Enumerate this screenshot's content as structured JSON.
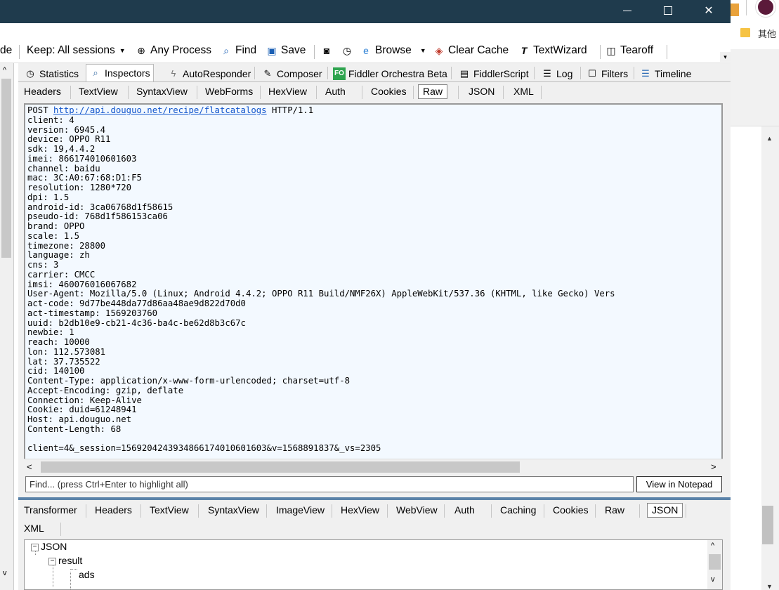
{
  "window": {
    "minimize_icon": "minimize-icon",
    "maximize_icon": "maximize-icon",
    "close_icon": "close-icon",
    "titlebar_color": "#1f3b4d"
  },
  "background_browser": {
    "bookmark_folder": "其他"
  },
  "toolbar": {
    "cut_label": "de",
    "keep_label": "Keep: All sessions",
    "any_process": "Any Process",
    "find": "Find",
    "save": "Save",
    "browse": "Browse",
    "clear_cache": "Clear Cache",
    "textwizard": "TextWizard",
    "tearoff": "Tearoff"
  },
  "tabs": {
    "statistics": "Statistics",
    "inspectors": "Inspectors",
    "autoresponder": "AutoResponder",
    "composer": "Composer",
    "fo_badge": "FO",
    "fiddler_orchestra": "Fiddler Orchestra Beta",
    "fiddlerscript": "FiddlerScript",
    "log": "Log",
    "filters": "Filters",
    "timeline": "Timeline"
  },
  "request_tabs": [
    "Headers",
    "TextView",
    "SyntaxView",
    "WebForms",
    "HexView",
    "Auth",
    "Cookies",
    "Raw",
    "JSON",
    "XML"
  ],
  "raw": {
    "method": "POST ",
    "url": "http://api.douguo.net/recipe/flatcatalogs",
    "protocol": " HTTP/1.1",
    "headers": "client: 4\nversion: 6945.4\ndevice: OPPO R11\nsdk: 19,4.4.2\nimei: 866174010601603\nchannel: baidu\nmac: 3C:A0:67:68:D1:F5\nresolution: 1280*720\ndpi: 1.5\nandroid-id: 3ca06768d1f58615\npseudo-id: 768d1f586153ca06\nbrand: OPPO\nscale: 1.5\ntimezone: 28800\nlanguage: zh\ncns: 3\ncarrier: CMCC\nimsi: 460076016067682\nUser-Agent: Mozilla/5.0 (Linux; Android 4.4.2; OPPO R11 Build/NMF26X) AppleWebKit/537.36 (KHTML, like Gecko) Vers\nact-code: 9d77be448da77d86aa48ae9d822d70d0\nact-timestamp: 1569203760\nuuid: b2db10e9-cb21-4c36-ba4c-be62d8b3c67c\nnewbie: 1\nreach: 10000\nlon: 112.573081\nlat: 37.735522\ncid: 140100\nContent-Type: application/x-www-form-urlencoded; charset=utf-8\nAccept-Encoding: gzip, deflate\nConnection: Keep-Alive\nCookie: duid=61248941\nHost: api.douguo.net\nContent-Length: 68\n\nclient=4&_session=1569204243934866174010601603&v=1568891837&_vs=2305"
  },
  "find": {
    "placeholder": "Find... (press Ctrl+Enter to highlight all)",
    "notepad_button": "View in Notepad"
  },
  "response_tabs": [
    "Transformer",
    "Headers",
    "TextView",
    "SyntaxView",
    "ImageView",
    "HexView",
    "WebView",
    "Auth",
    "Caching",
    "Cookies",
    "Raw",
    "JSON",
    "XML"
  ],
  "tree": {
    "root": "JSON",
    "child": "result",
    "grandchild": "ads"
  }
}
